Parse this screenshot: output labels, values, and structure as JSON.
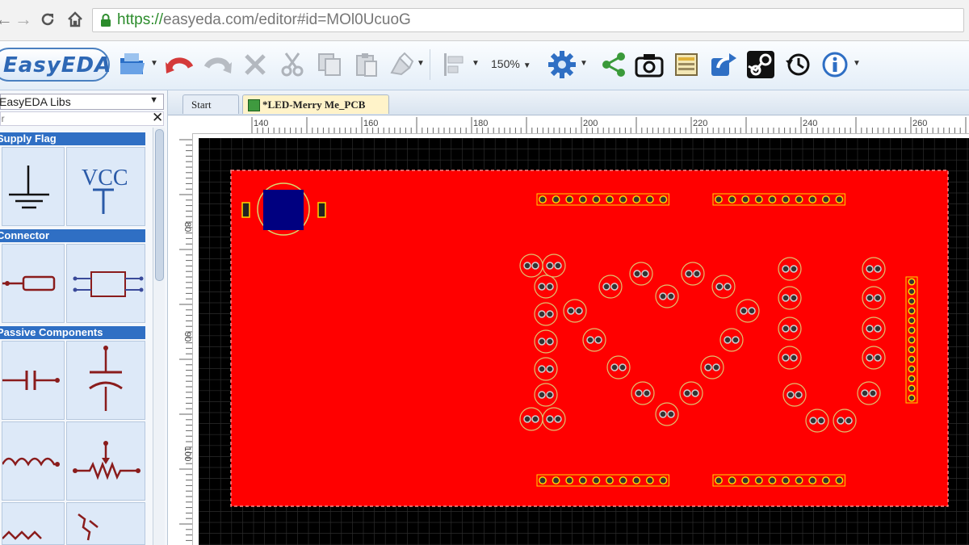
{
  "browser": {
    "url_scheme": "https://",
    "url_rest": "easyeda.com/editor#id=MOl0UcuoG"
  },
  "app": {
    "logo_text": "EasyEDA",
    "zoom": "150%"
  },
  "toolbar": {
    "icons": [
      "open-folder-icon",
      "undo-icon",
      "redo-icon",
      "delete-icon",
      "cut-icon",
      "copy-icon",
      "paste-icon",
      "paint-icon",
      "align-icon",
      "zoom-dropdown",
      "settings-gear-icon",
      "share-icon",
      "camera-icon",
      "document-icon",
      "export-icon",
      "steam-icon",
      "history-icon",
      "info-icon"
    ]
  },
  "libs": {
    "selected": "EasyEDA Libs",
    "search_placeholder": "Filter",
    "categories": [
      {
        "label": "Supply Flag",
        "items": [
          "ground-symbol",
          "vcc-symbol"
        ]
      },
      {
        "label": "Connector",
        "items": [
          "connector-2pin-symbol",
          "connector-header-symbol"
        ]
      },
      {
        "label": "Passive Components",
        "items": [
          "capacitor-symbol",
          "variable-capacitor-symbol",
          "inductor-symbol",
          "potentiometer-symbol",
          "resistor-symbol",
          "diode-zigzag-symbol"
        ]
      }
    ],
    "vcc_label": "VCC"
  },
  "tabs": [
    {
      "label": "Start"
    },
    {
      "label": "*LED-Merry Me_PCB"
    }
  ],
  "ruler": {
    "top_labels": [
      "140",
      "160",
      "180",
      "200",
      "220",
      "240",
      "260"
    ],
    "left_labels": [
      "80",
      "90",
      "100"
    ]
  },
  "colors": {
    "board": "#ff0000",
    "board_bg": "#000000",
    "pad": "#ffd700",
    "accent": "#2f6fc4"
  }
}
